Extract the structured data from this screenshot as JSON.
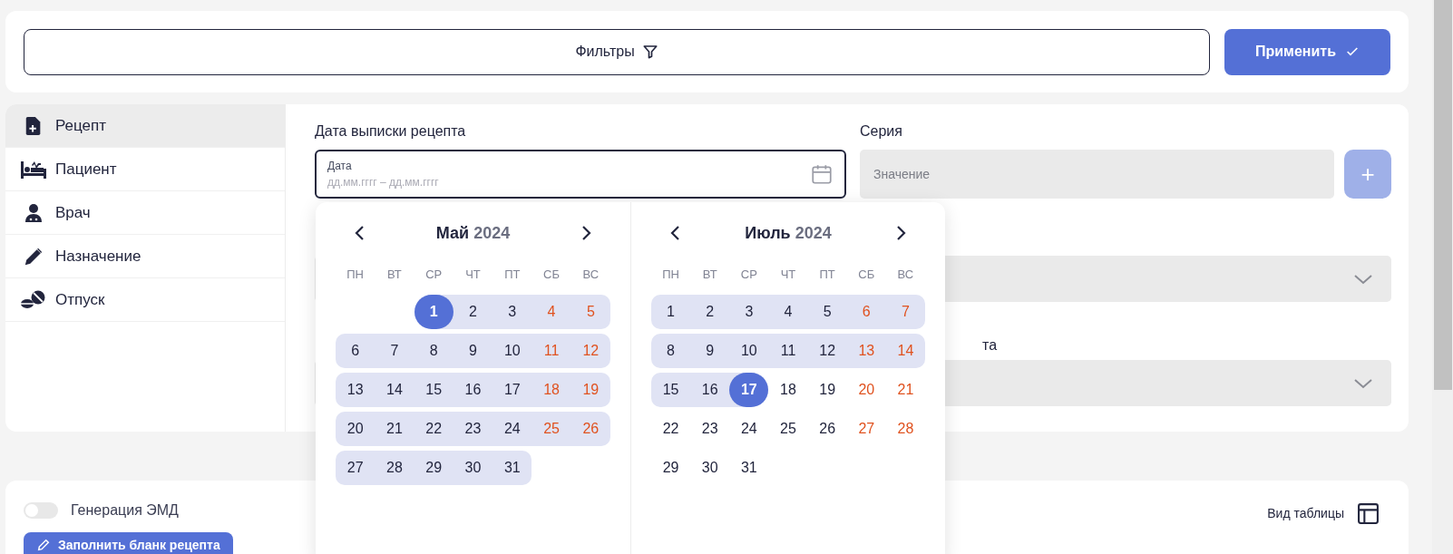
{
  "filter_bar": {
    "filters_button": "Фильтры",
    "apply_button": "Применить"
  },
  "sidebar": {
    "items": [
      {
        "label": "Рецепт",
        "selected": true
      },
      {
        "label": "Пациент",
        "selected": false
      },
      {
        "label": "Врач",
        "selected": false
      },
      {
        "label": "Назначение",
        "selected": false
      },
      {
        "label": "Отпуск",
        "selected": false
      }
    ]
  },
  "form": {
    "date_label": "Дата выписки рецепта",
    "date_field": {
      "label": "Дата",
      "placeholder": "дд.мм.гггг – дд.мм.гггг"
    },
    "series_label": "Серия",
    "series_field": {
      "placeholder": "Значение"
    },
    "add_button": "+",
    "partial_label": "та"
  },
  "calendar": {
    "months": [
      {
        "month": "Май",
        "year": "2024",
        "weekdays": [
          "ПН",
          "ВТ",
          "СР",
          "ЧТ",
          "ПТ",
          "СБ",
          "ВС"
        ],
        "weeks": [
          [
            {
              "day": "1",
              "in_range": true,
              "selected": true
            },
            {
              "day": "2",
              "in_range": true,
              "selected": false
            },
            {
              "day": "3",
              "in_range": true,
              "selected": false
            },
            {
              "day": "4",
              "in_range": true,
              "selected": false
            },
            {
              "day": "5",
              "in_range": true,
              "selected": false
            }
          ],
          [
            {
              "day": "6",
              "in_range": true,
              "selected": false
            },
            {
              "day": "7",
              "in_range": true,
              "selected": false
            },
            {
              "day": "8",
              "in_range": true,
              "selected": false
            },
            {
              "day": "9",
              "in_range": true,
              "selected": false
            },
            {
              "day": "10",
              "in_range": true,
              "selected": false
            },
            {
              "day": "11",
              "in_range": true,
              "selected": false
            },
            {
              "day": "12",
              "in_range": true,
              "selected": false
            }
          ],
          [
            {
              "day": "13",
              "in_range": true,
              "selected": false
            },
            {
              "day": "14",
              "in_range": true,
              "selected": false
            },
            {
              "day": "15",
              "in_range": true,
              "selected": false
            },
            {
              "day": "16",
              "in_range": true,
              "selected": false
            },
            {
              "day": "17",
              "in_range": true,
              "selected": false
            },
            {
              "day": "18",
              "in_range": true,
              "selected": false
            },
            {
              "day": "19",
              "in_range": true,
              "selected": false
            }
          ],
          [
            {
              "day": "20",
              "in_range": true,
              "selected": false
            },
            {
              "day": "21",
              "in_range": true,
              "selected": false
            },
            {
              "day": "22",
              "in_range": true,
              "selected": false
            },
            {
              "day": "23",
              "in_range": true,
              "selected": false
            },
            {
              "day": "24",
              "in_range": true,
              "selected": false
            },
            {
              "day": "25",
              "in_range": true,
              "selected": false
            },
            {
              "day": "26",
              "in_range": true,
              "selected": false
            }
          ],
          [
            {
              "day": "27",
              "in_range": true,
              "selected": false
            },
            {
              "day": "28",
              "in_range": true,
              "selected": false
            },
            {
              "day": "29",
              "in_range": true,
              "selected": false
            },
            {
              "day": "30",
              "in_range": true,
              "selected": false
            },
            {
              "day": "31",
              "in_range": true,
              "selected": false
            }
          ]
        ]
      },
      {
        "month": "Июль",
        "year": "2024",
        "weekdays": [
          "ПН",
          "ВТ",
          "СР",
          "ЧТ",
          "ПТ",
          "СБ",
          "ВС"
        ],
        "weeks": [
          [
            {
              "day": "1",
              "in_range": true,
              "selected": false
            },
            {
              "day": "2",
              "in_range": true,
              "selected": false
            },
            {
              "day": "3",
              "in_range": true,
              "selected": false
            },
            {
              "day": "4",
              "in_range": true,
              "selected": false
            },
            {
              "day": "5",
              "in_range": true,
              "selected": false
            },
            {
              "day": "6",
              "in_range": true,
              "selected": false
            },
            {
              "day": "7",
              "in_range": true,
              "selected": false
            }
          ],
          [
            {
              "day": "8",
              "in_range": true,
              "selected": false
            },
            {
              "day": "9",
              "in_range": true,
              "selected": false
            },
            {
              "day": "10",
              "in_range": true,
              "selected": false
            },
            {
              "day": "11",
              "in_range": true,
              "selected": false
            },
            {
              "day": "12",
              "in_range": true,
              "selected": false
            },
            {
              "day": "13",
              "in_range": true,
              "selected": false
            },
            {
              "day": "14",
              "in_range": true,
              "selected": false
            }
          ],
          [
            {
              "day": "15",
              "in_range": true,
              "selected": false
            },
            {
              "day": "16",
              "in_range": true,
              "selected": false
            },
            {
              "day": "17",
              "in_range": true,
              "selected": true
            },
            {
              "day": "18",
              "in_range": false,
              "selected": false
            },
            {
              "day": "19",
              "in_range": false,
              "selected": false
            },
            {
              "day": "20",
              "in_range": false,
              "selected": false
            },
            {
              "day": "21",
              "in_range": false,
              "selected": false
            }
          ],
          [
            {
              "day": "22",
              "in_range": false,
              "selected": false
            },
            {
              "day": "23",
              "in_range": false,
              "selected": false
            },
            {
              "day": "24",
              "in_range": false,
              "selected": false
            },
            {
              "day": "25",
              "in_range": false,
              "selected": false
            },
            {
              "day": "26",
              "in_range": false,
              "selected": false
            },
            {
              "day": "27",
              "in_range": false,
              "selected": false
            },
            {
              "day": "28",
              "in_range": false,
              "selected": false
            }
          ],
          [
            {
              "day": "29",
              "in_range": false,
              "selected": false
            },
            {
              "day": "30",
              "in_range": false,
              "selected": false
            },
            {
              "day": "31",
              "in_range": false,
              "selected": false
            }
          ]
        ]
      }
    ]
  },
  "bottom": {
    "emd_toggle": {
      "label": "Генерация ЭМД",
      "on": false
    },
    "fill_button": "Заполнить бланк рецепта",
    "table_view": "Вид таблицы"
  }
}
